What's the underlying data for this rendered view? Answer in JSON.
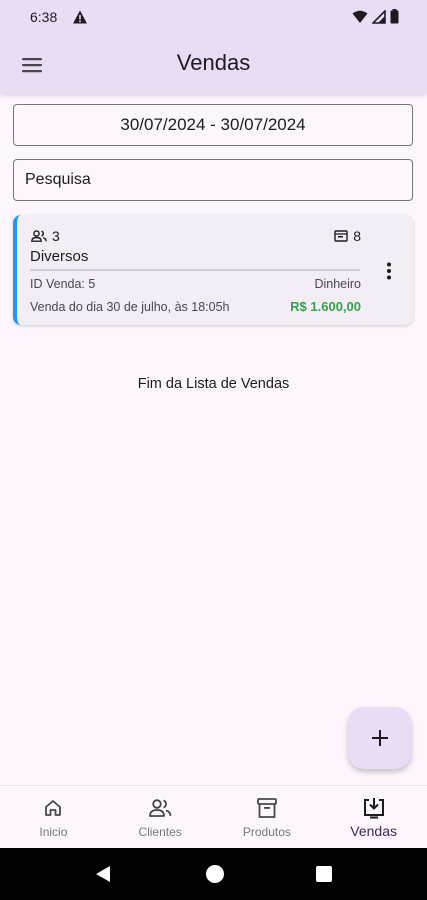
{
  "status_bar": {
    "time": "6:38"
  },
  "app_bar": {
    "title": "Vendas"
  },
  "filters": {
    "date_range": "30/07/2024 - 30/07/2024",
    "search_placeholder": "Pesquisa"
  },
  "sales": [
    {
      "clients_count": "3",
      "items_count": "8",
      "name": "Diversos",
      "id_label": "ID Venda: 5",
      "payment": "Dinheiro",
      "date_text": "Venda do dia 30 de julho, às 18:05h",
      "amount": "R$ 1.600,00",
      "accent_color": "#2196f3",
      "amount_color": "#35a245"
    }
  ],
  "list_end_text": "Fim da Lista de Vendas",
  "bottom_nav": {
    "items": [
      {
        "label": "Inicio",
        "icon": "home-icon",
        "active": false
      },
      {
        "label": "Clientes",
        "icon": "clients-icon",
        "active": false
      },
      {
        "label": "Produtos",
        "icon": "products-icon",
        "active": false
      },
      {
        "label": "Vendas",
        "icon": "sales-icon",
        "active": true
      }
    ]
  },
  "colors": {
    "app_bar": "#e9ddf6",
    "background": "#fdf7fd",
    "active_nav": "#3b2a56"
  }
}
